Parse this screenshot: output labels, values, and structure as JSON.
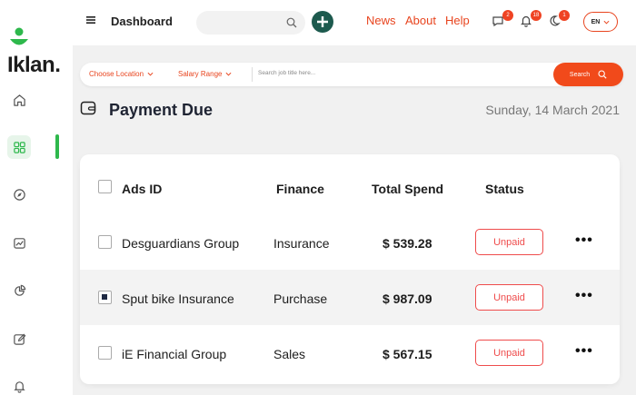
{
  "brand": {
    "name": "Iklan.",
    "accent": "#2eb84c"
  },
  "sidebar": {
    "items": [
      {
        "icon": "home-icon"
      },
      {
        "icon": "grid-icon",
        "active": true
      },
      {
        "icon": "compass-icon"
      },
      {
        "icon": "chart-icon"
      },
      {
        "icon": "pie-icon"
      },
      {
        "icon": "edit-icon"
      },
      {
        "icon": "bell-icon"
      }
    ]
  },
  "topbar": {
    "title": "Dashboard",
    "links": [
      "News",
      "About",
      "Help"
    ],
    "notifications": [
      {
        "icon": "chat-icon",
        "count": "2"
      },
      {
        "icon": "bell-icon",
        "count": "18"
      },
      {
        "icon": "moon-icon",
        "count": "1"
      }
    ],
    "language": "EN"
  },
  "filter": {
    "location_label": "Choose Location",
    "salary_label": "Salary Range",
    "placeholder": "Search job title here...",
    "search_label": "Search"
  },
  "page": {
    "title": "Payment Due",
    "date": "Sunday, 14 March 2021"
  },
  "table": {
    "headers": {
      "id": "Ads ID",
      "finance": "Finance",
      "total": "Total Spend",
      "status": "Status"
    },
    "rows": [
      {
        "name": "Desguardians Group",
        "finance": "Insurance",
        "amount": "$ 539.28",
        "status": "Unpaid",
        "checked": false
      },
      {
        "name": "Sput bike Insurance",
        "finance": "Purchase",
        "amount": "$ 987.09",
        "status": "Unpaid",
        "checked": true
      },
      {
        "name": "iE Financial Group",
        "finance": "Sales",
        "amount": "$ 567.15",
        "status": "Unpaid",
        "checked": false
      }
    ],
    "more_glyph": "•••"
  }
}
